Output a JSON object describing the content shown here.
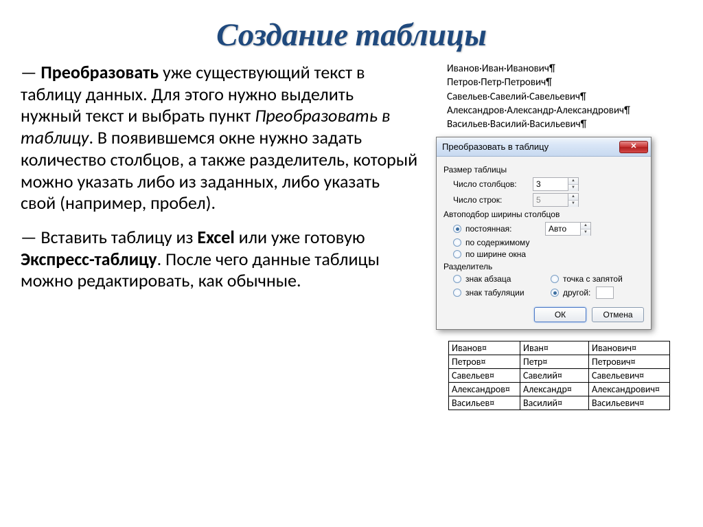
{
  "title": "Создание таблицы",
  "para1_parts": {
    "dash": "— ",
    "bold1": "Преобразовать",
    "t1": " уже существующий текст в таблицу данных. Для этого нужно выделить нужный текст и выбрать пункт ",
    "italic": "Преобразовать в таблицу",
    "t2": ". В появившемся окне нужно задать количество столбцов, а также разделитель, который  можно указать либо из заданных, либо указать свой (например, пробел)."
  },
  "para2_parts": {
    "dash": "— Вставить таблицу из ",
    "bold1": "Excel",
    "t1": " или уже готовую ",
    "bold2": "Экспресс-таблицу",
    "t2": ". После чего данные таблицы можно редактировать, как обычные."
  },
  "names": [
    "Иванов·Иван·Иванович¶",
    "Петров·Петр·Петрович¶",
    "Савельев·Савелий·Савельевич¶",
    "Александров·Александр·Александрович¶",
    "Васильев·Василий·Васильевич¶"
  ],
  "dialog": {
    "title": "Преобразовать в таблицу",
    "size_group": "Размер таблицы",
    "cols_label": "Число столбцов:",
    "cols_value": "3",
    "rows_label": "Число строк:",
    "rows_value": "5",
    "width_group": "Автоподбор ширины столбцов",
    "opt_fixed": "постоянная:",
    "fixed_value": "Авто",
    "opt_content": "по содержимому",
    "opt_window": "по ширине окна",
    "sep_group": "Разделитель",
    "sep_para": "знак абзаца",
    "sep_semi": "точка с запятой",
    "sep_tab": "знак табуляции",
    "sep_other": "другой:",
    "btn_ok": "ОК",
    "btn_cancel": "Отмена"
  },
  "result_rows": [
    [
      "Иванов¤",
      "Иван¤",
      "Иванович¤"
    ],
    [
      "Петров¤",
      "Петр¤",
      "Петрович¤"
    ],
    [
      "Савельев¤",
      "Савелий¤",
      "Савельевич¤"
    ],
    [
      "Александров¤",
      "Александр¤",
      "Александрович¤"
    ],
    [
      "Васильев¤",
      "Василий¤",
      "Васильевич¤"
    ]
  ]
}
